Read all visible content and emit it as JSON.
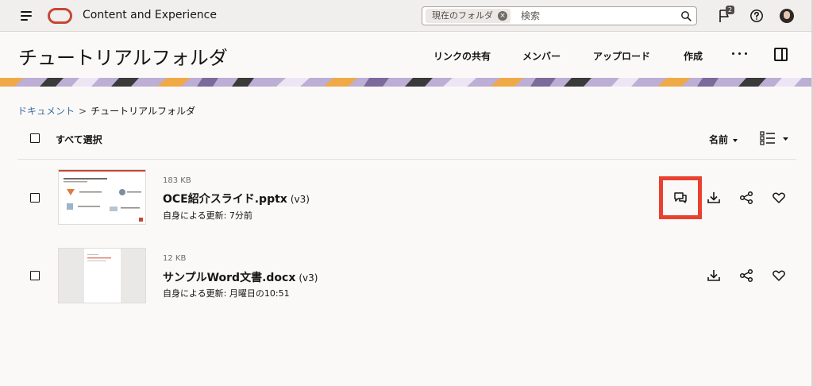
{
  "app": {
    "title": "Content and Experience",
    "notification_count": "2",
    "accent_color": "#c74634"
  },
  "search": {
    "scope_chip": "現在のフォルダ",
    "placeholder": "検索"
  },
  "header": {
    "title": "チュートリアルフォルダ",
    "actions": {
      "share_link": "リンクの共有",
      "members": "メンバー",
      "upload": "アップロード",
      "create": "作成"
    }
  },
  "breadcrumb": {
    "root": "ドキュメント",
    "separator": ">",
    "current": "チュートリアルフォルダ"
  },
  "list": {
    "select_all": "すべて選択",
    "sort_label": "名前",
    "files": [
      {
        "size": "183 KB",
        "name": "OCE紹介スライド.pptx",
        "version": "(v3)",
        "meta": "自身による更新: 7分前",
        "has_conversation_action": true
      },
      {
        "size": "12 KB",
        "name": "サンプルWord文書.docx",
        "version": "(v3)",
        "meta": "自身による更新: 月曜日の10:51",
        "has_conversation_action": false
      }
    ]
  },
  "highlight_color": "#e8412f"
}
